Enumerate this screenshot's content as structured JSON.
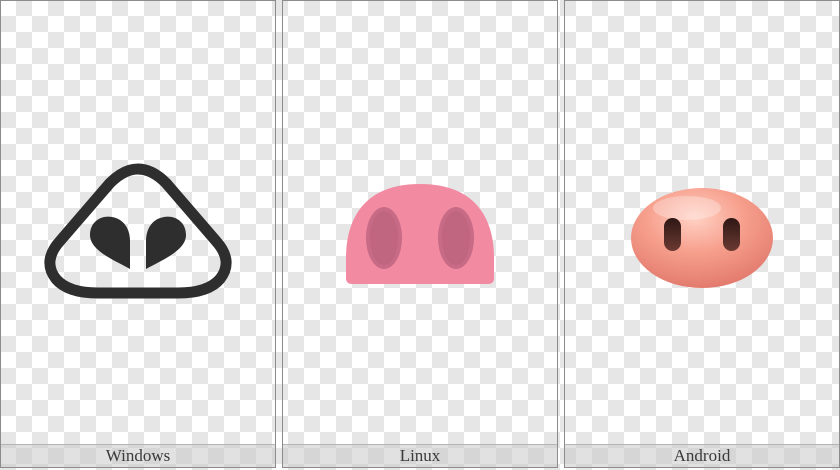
{
  "panels": [
    {
      "label": "Windows",
      "icon": "pig-nose-icon",
      "style": "outline-monochrome",
      "colors": {
        "stroke": "#2e2e2e"
      }
    },
    {
      "label": "Linux",
      "icon": "pig-nose-icon",
      "style": "flat-color",
      "colors": {
        "body": "#f28aa2",
        "nostril": "#c76b86"
      }
    },
    {
      "label": "Android",
      "icon": "pig-nose-icon",
      "style": "glossy-color",
      "colors": {
        "body": "#f7a08e",
        "nostril": "#4a2a24"
      }
    }
  ],
  "background": {
    "pattern": "checkerboard",
    "colors": [
      "#ffffff",
      "#e6e6e6"
    ]
  }
}
